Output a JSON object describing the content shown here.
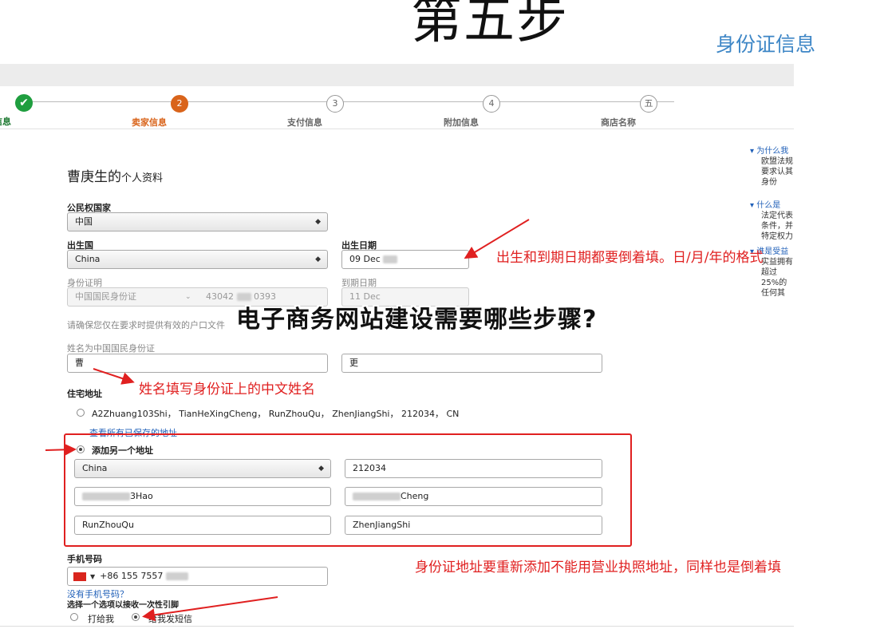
{
  "header": {
    "step_title": "第五步",
    "section_title": "身份证信息"
  },
  "progress": {
    "steps": [
      {
        "label": "商业信息",
        "marker": "✔",
        "state": "done"
      },
      {
        "label": "卖家信息",
        "marker": "2",
        "state": "active"
      },
      {
        "label": "支付信息",
        "marker": "3",
        "state": "pending"
      },
      {
        "label": "附加信息",
        "marker": "4",
        "state": "pending"
      },
      {
        "label": "商店名称",
        "marker": "五",
        "state": "pending"
      }
    ]
  },
  "form": {
    "heading_name": "曹庚生的",
    "heading_suffix": "个人资料",
    "citizenship_label": "公民权国家",
    "citizenship_value": "中国",
    "birth_country_label": "出生国",
    "birth_country_value": "China",
    "birth_date_label": "出生日期",
    "birth_date_value": "09 Dec",
    "id_label": "身份证明",
    "id_type_value": "中国国民身份证",
    "id_number_start": "43042",
    "id_number_end": "0393",
    "expiry_label": "到期日期",
    "expiry_value": "11 Dec",
    "id_note": "请确保您仅在要求时提供有效的户口文件",
    "chinese_name_label": "姓名为中国国民身份证",
    "surname_value": "曹",
    "given_name_value": "更",
    "address_label": "住宅地址",
    "saved_address": "A2Zhuang103Shi， TianHeXingCheng， RunZhouQu， ZhenJiangShi， 212034， CN",
    "view_saved_link": "查看所有已保存的地址",
    "add_address_label": "添加另一个地址",
    "address_country": "China",
    "postal_code": "212034",
    "address_line1_end": "3Hao",
    "address_line2_end": "Cheng",
    "district": "RunZhouQu",
    "city": "ZhenJiangShi",
    "phone_label": "手机号码",
    "phone_value": "+86 155 7557",
    "no_phone_link": "没有手机号码？",
    "verify_label": "选择一个选项以接收一次性引脚",
    "option_call": "打给我",
    "option_sms": "给我发短信"
  },
  "annotations": {
    "date_note": "出生和到期日期都要倒着填。日/月/年的格式",
    "name_note": "姓名填写身份证上的中文姓名",
    "address_note": "身份证地址要重新添加不能用营业执照地址，同样也是倒着填",
    "overlay_title": "电子商务网站建设需要哪些步骤?"
  },
  "help": {
    "q1": "为什么我",
    "a1": "欧盟法规要求认其身份",
    "q2": "什么是",
    "a2": "法定代表条件，并特定权力",
    "q3": "谁是受益",
    "a3": "实益拥有超过25%的任何其"
  },
  "colors": {
    "accent_red": "#e02020",
    "link_blue": "#1f5fb8",
    "done_green": "#1f9e3f",
    "active_orange": "#d9641b"
  }
}
